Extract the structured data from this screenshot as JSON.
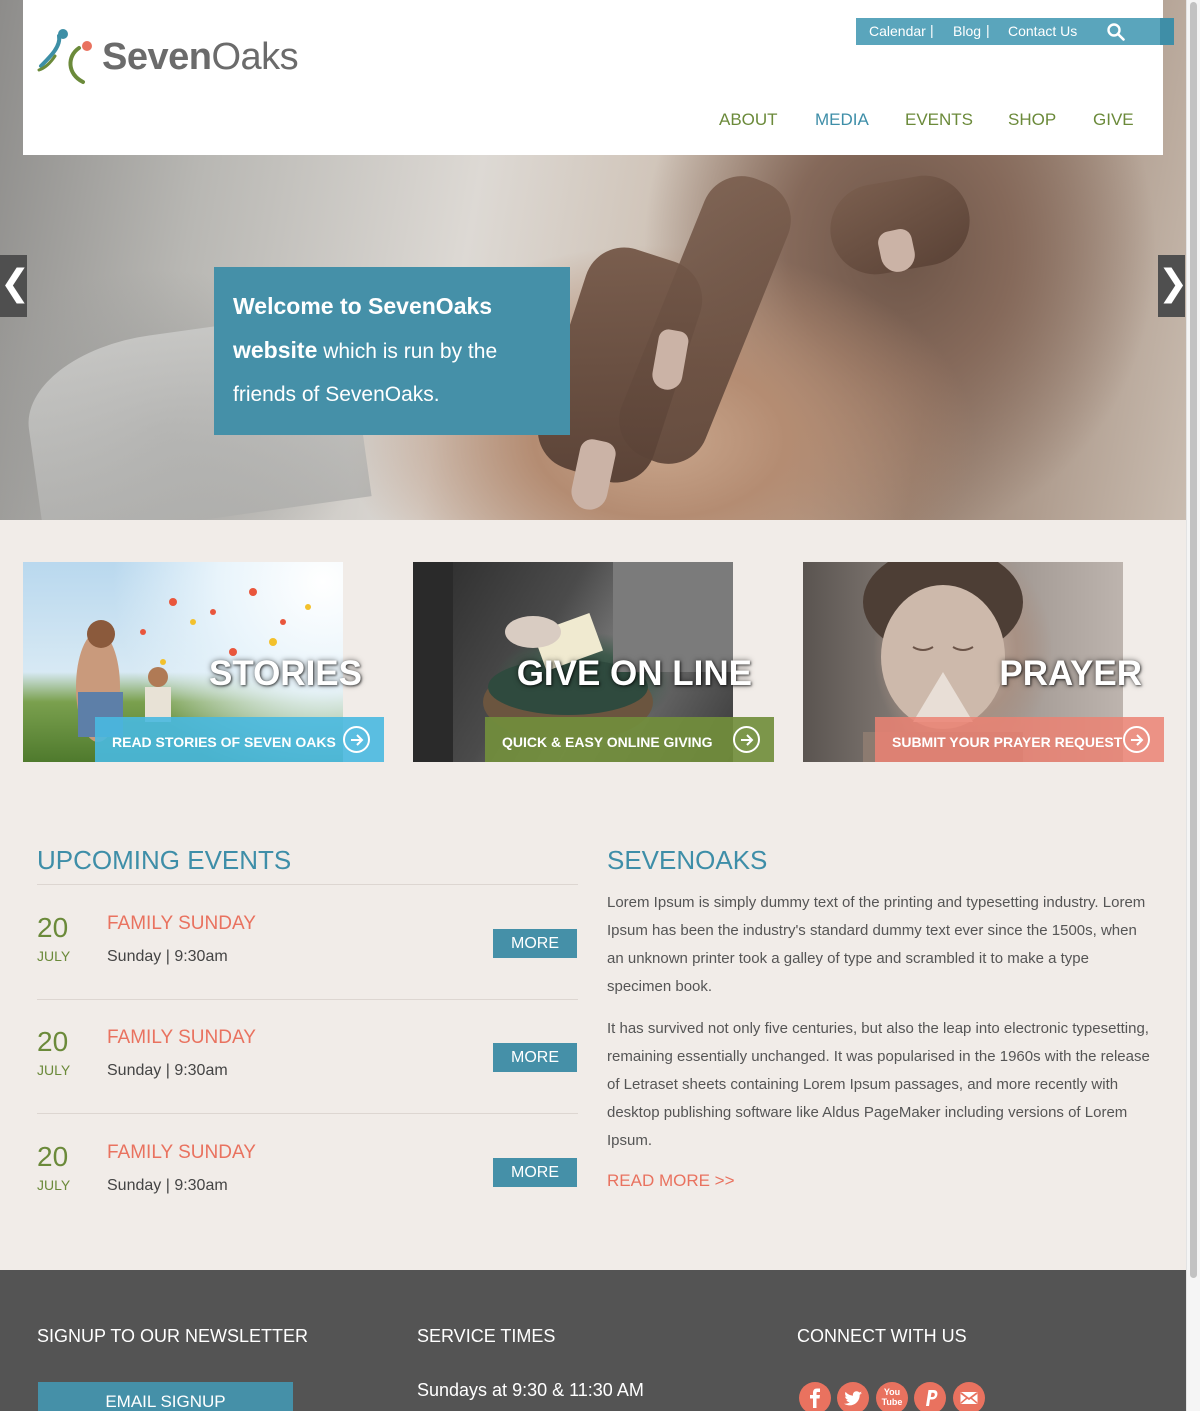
{
  "brand": {
    "name_bold": "Seven",
    "name_light": "Oaks"
  },
  "topbar": {
    "calendar": "Calendar",
    "blog": "Blog",
    "contact": "Contact Us",
    "separator": "|"
  },
  "nav": {
    "about": "ABOUT",
    "media": "MEDIA",
    "events": "EVENTS",
    "shop": "SHOP",
    "give": "GIVE"
  },
  "hero": {
    "welcome_bold_1": "Welcome to SevenOaks",
    "welcome_bold_2": "website",
    "welcome_rest_1": " which is run by the",
    "welcome_rest_2": "friends of SevenOaks.",
    "prev": "❮",
    "next": "❯"
  },
  "cards": [
    {
      "title": "STORIES",
      "cta": "READ STORIES OF SEVEN OAKS"
    },
    {
      "title": "GIVE ON LINE",
      "cta": "QUICK & EASY ONLINE GIVING"
    },
    {
      "title": "PRAYER",
      "cta": "SUBMIT YOUR PRAYER REQUEST"
    }
  ],
  "events": {
    "title": "UPCOMING EVENTS",
    "more_label": "MORE",
    "items": [
      {
        "day": "20",
        "month": "JULY",
        "name": "FAMILY SUNDAY",
        "time": "Sunday | 9:30am"
      },
      {
        "day": "20",
        "month": "JULY",
        "name": "FAMILY SUNDAY",
        "time": "Sunday | 9:30am"
      },
      {
        "day": "20",
        "month": "JULY",
        "name": "FAMILY SUNDAY",
        "time": "Sunday | 9:30am"
      }
    ]
  },
  "about": {
    "title": "SEVENOAKS",
    "para1": "Lorem Ipsum is simply dummy text of the printing and typesetting industry. Lorem Ipsum has been the industry's standard dummy text ever since the 1500s, when an unknown printer took a galley of type and scrambled it to make a type specimen book.",
    "para2": "It has survived not only five centuries, but also the leap into electronic typesetting, remaining essentially unchanged. It was popularised in the 1960s with the release of Letraset sheets containing Lorem Ipsum passages, and more recently with desktop publishing software like Aldus PageMaker including versions of Lorem Ipsum.",
    "read_more": "READ MORE >>"
  },
  "footer": {
    "newsletter_title": "SIGNUP TO OUR NEWSLETTER",
    "signup_label": "EMAIL SIGNUP",
    "service_title": "SERVICE TIMES",
    "service_time": "Sundays at 9:30 & 11:30 AM",
    "connect_title": "CONNECT WITH US",
    "youtube_label": "You Tube",
    "social_icons": [
      "facebook-icon",
      "twitter-icon",
      "youtube-icon",
      "paypal-icon",
      "email-icon"
    ]
  },
  "colors": {
    "accent_blue": "#4590a8",
    "accent_green": "#6b8a3a",
    "accent_coral": "#e9725f",
    "footer_bg": "#545454",
    "page_bg": "#f1ece8"
  }
}
